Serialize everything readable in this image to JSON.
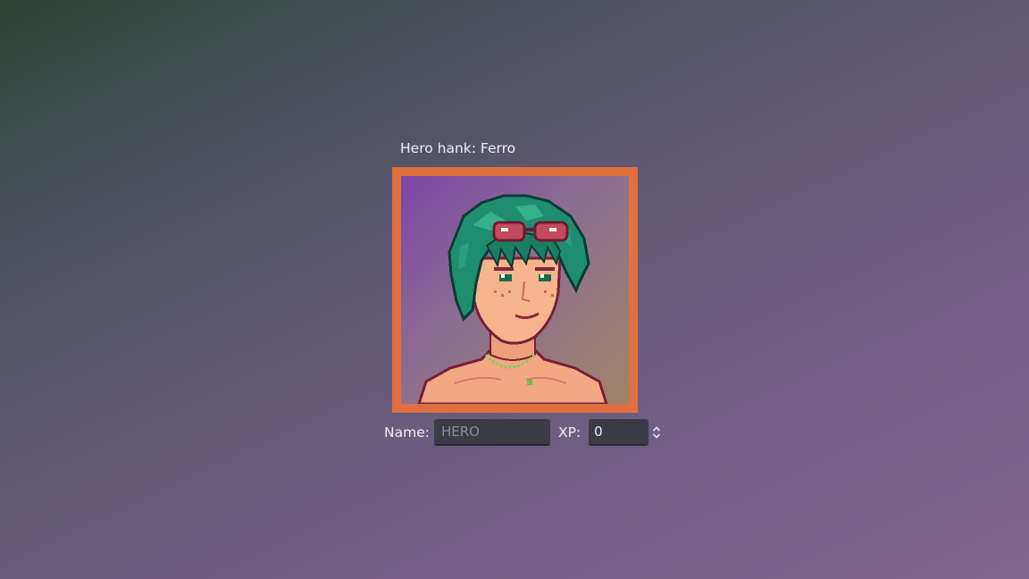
{
  "header": {
    "title": "Hero hank: Ferro"
  },
  "portrait": {
    "description_icon": "character-portrait",
    "frame_color": "#e07040"
  },
  "form": {
    "name_label": "Name:",
    "name_placeholder": "HERO",
    "name_value": "",
    "xp_label": "XP:",
    "xp_value": "0"
  },
  "colors": {
    "accent": "#e07040",
    "input_bg": "#3d3a47"
  }
}
